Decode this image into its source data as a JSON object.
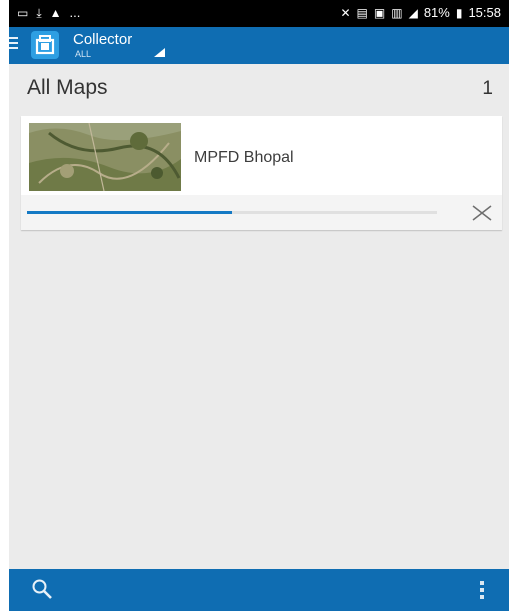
{
  "status_bar": {
    "left_icons": [
      "image-icon",
      "download-icon",
      "warning-icon"
    ],
    "left_ellipsis": "...",
    "right_icons": [
      "mute-icon",
      "volte-icon",
      "sim-icon",
      "lte-signal-icon",
      "signal-icon"
    ],
    "battery": "81%",
    "time": "15:58"
  },
  "app_bar": {
    "title": "Collector",
    "filter": "ALL",
    "accent": "#0f6db2"
  },
  "maps": {
    "header": "All Maps",
    "count": "1",
    "items": [
      {
        "name": "MPFD Bhopal",
        "download_progress": 0.5
      }
    ]
  },
  "bottom_bar": {
    "icons": [
      "search-icon",
      "more-vert-icon"
    ]
  }
}
